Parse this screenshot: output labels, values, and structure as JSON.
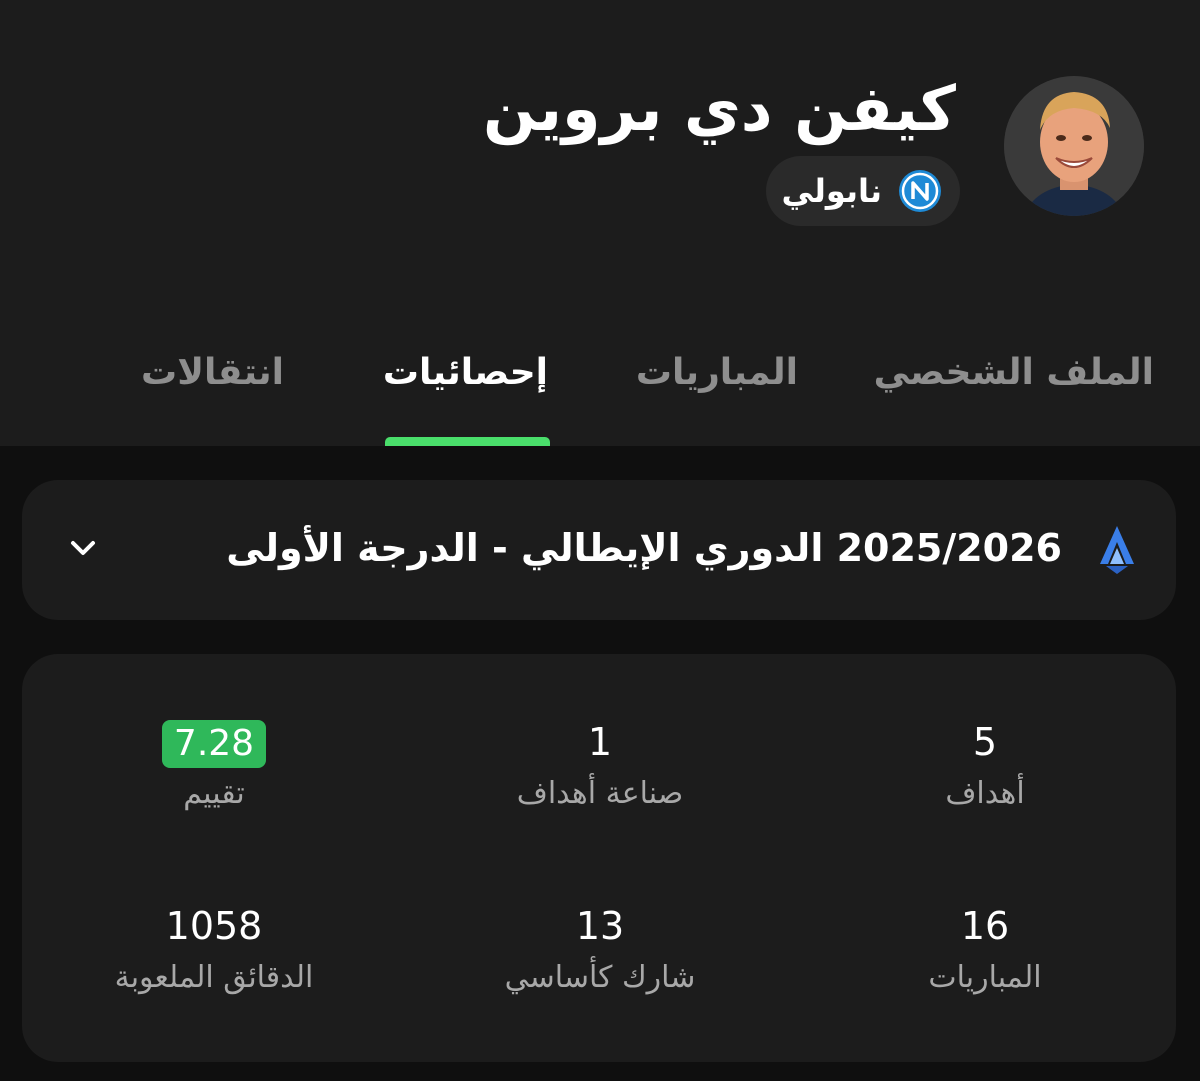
{
  "player": {
    "name": "كيفن دي بروين",
    "team": "نابولي"
  },
  "tabs": [
    {
      "label": "الملف الشخصي",
      "active": false
    },
    {
      "label": "المباريات",
      "active": false
    },
    {
      "label": "إحصائيات",
      "active": true
    },
    {
      "label": "انتقالات",
      "active": false
    }
  ],
  "league": {
    "title": "2025/2026 الدوري الإيطالي - الدرجة الأولى",
    "logo_icon": "serie-a-icon",
    "dropdown_icon": "chevron-down-icon"
  },
  "stats": [
    {
      "value": "5",
      "label": "أهداف"
    },
    {
      "value": "1",
      "label": "صناعة أهداف"
    },
    {
      "value": "7.28",
      "label": "تقييم"
    },
    {
      "value": "16",
      "label": "المباريات"
    },
    {
      "value": "13",
      "label": "شارك كأساسي"
    },
    {
      "value": "1058",
      "label": "الدقائق الملعوبة"
    }
  ],
  "colors": {
    "accent": "#4ade6b",
    "rating_badge": "#2fb85a",
    "background": "#0f0f0f",
    "card": "#1c1c1c"
  }
}
